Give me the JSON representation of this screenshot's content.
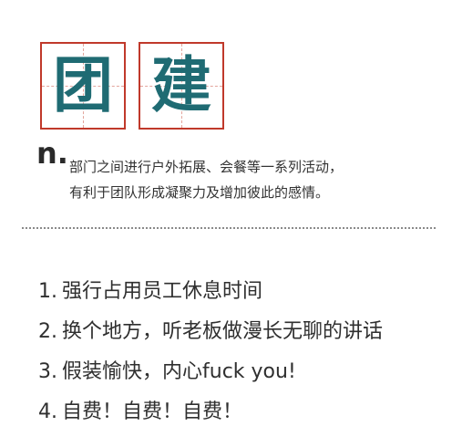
{
  "header": {
    "chars": [
      "团",
      "建"
    ]
  },
  "definition": {
    "pos": "n.",
    "lines": [
      "部门之间进行户外拓展、会餐等一系列活动，",
      "有利于团队形成凝聚力及增加彼此的感情。"
    ]
  },
  "list": {
    "items": [
      {
        "num": "1.",
        "text": "强行占用员工休息时间"
      },
      {
        "num": "2.",
        "text": "换个地方，听老板做漫长无聊的讲话"
      },
      {
        "num": "3.",
        "text": "假装愉快，内心fuck you!"
      },
      {
        "num": "4.",
        "text": "自费！自费！自费！"
      }
    ]
  },
  "colors": {
    "box_border": "#c0392b",
    "char": "#1f6b73",
    "text": "#2a2a2a"
  }
}
